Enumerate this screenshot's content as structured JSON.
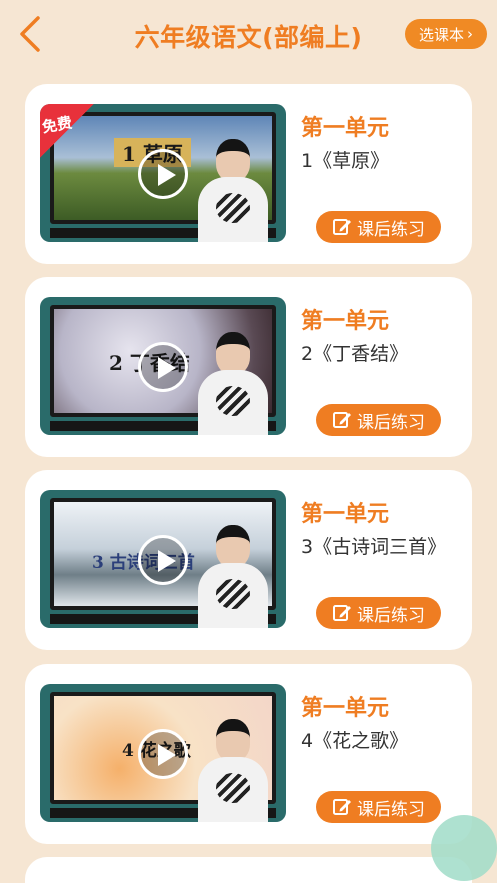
{
  "header": {
    "title": "六年级语文(部编上)",
    "select_label": "选课本",
    "select_chevron": "›"
  },
  "lessons": [
    {
      "unit": "第一单元",
      "title": "1《草原》",
      "screen_text": "1 草原",
      "badge": "免费",
      "practice_label": "课后练习"
    },
    {
      "unit": "第一单元",
      "title": "2《丁香结》",
      "screen_text": "2 丁香结",
      "practice_label": "课后练习"
    },
    {
      "unit": "第一单元",
      "title": "3《古诗词三首》",
      "screen_text": "3 古诗词三首",
      "practice_label": "课后练习"
    },
    {
      "unit": "第一单元",
      "title": "4《花之歌》",
      "screen_text": "4 花之歌",
      "practice_label": "课后练习"
    }
  ],
  "colors": {
    "accent": "#ef7d22",
    "background": "#f6e6d3",
    "badge_red": "#e8313b"
  }
}
